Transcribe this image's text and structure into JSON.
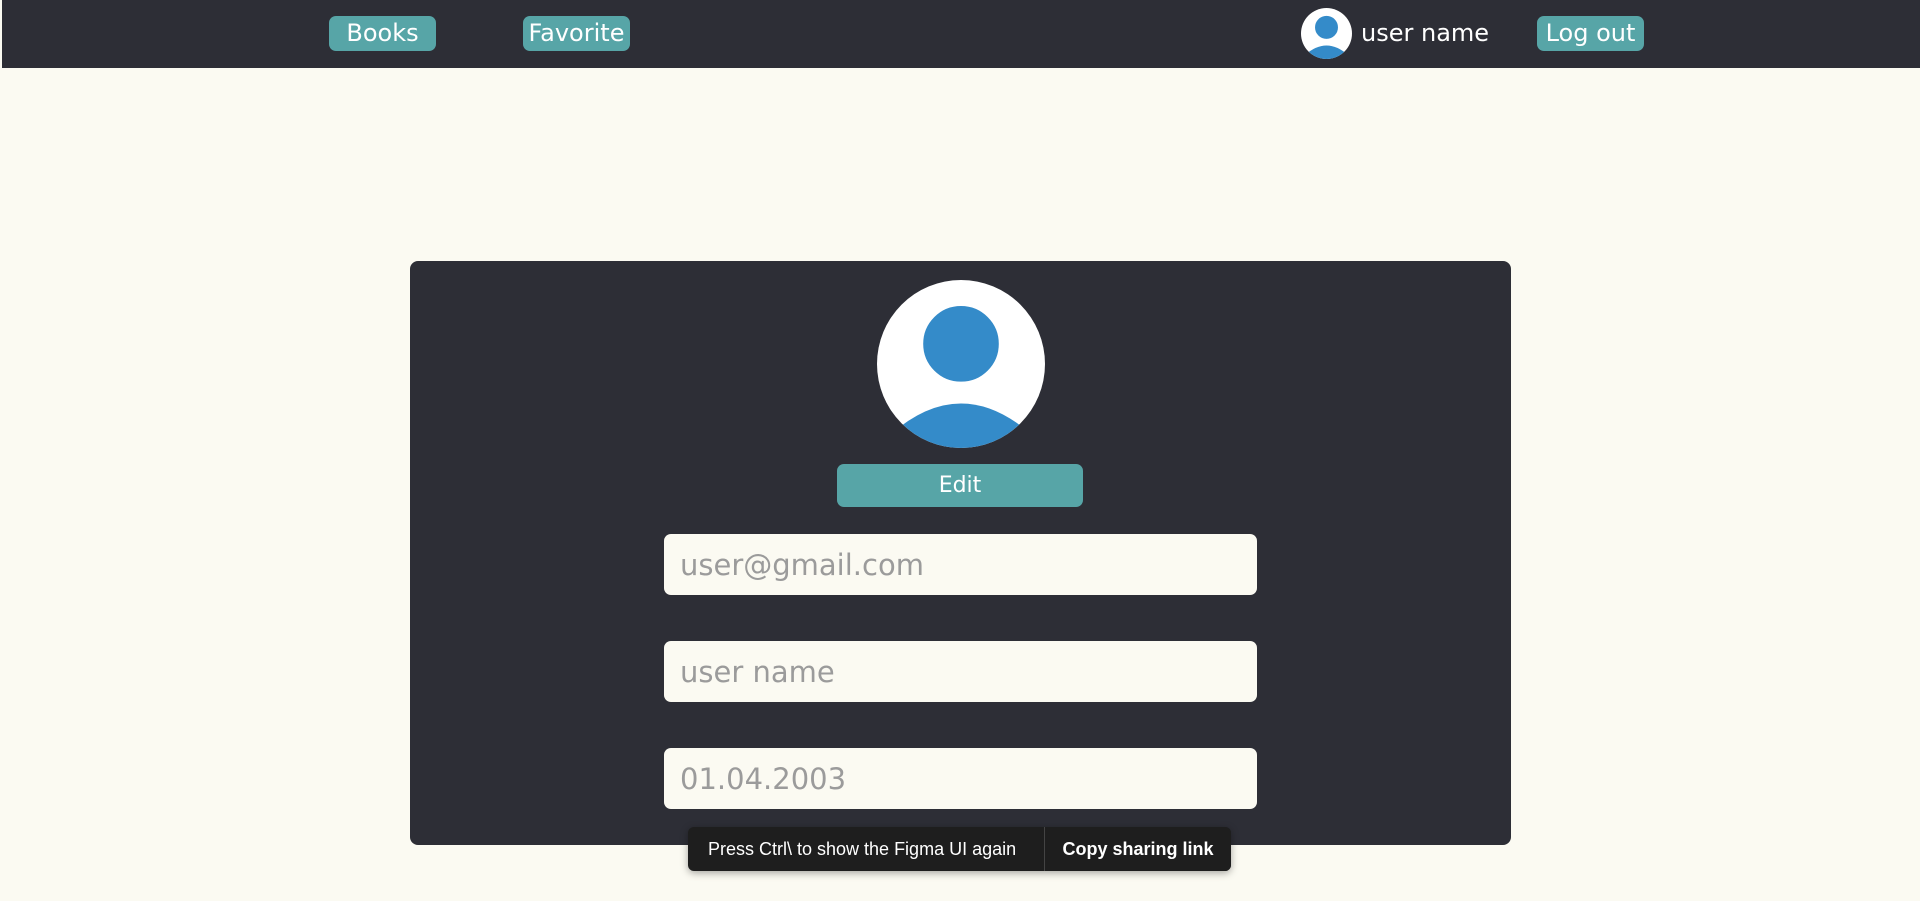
{
  "header": {
    "nav": {
      "books_label": "Books",
      "favorite_label": "Favorite"
    },
    "user_name": "user name",
    "logout_label": "Log out"
  },
  "profile": {
    "edit_label": "Edit",
    "fields": {
      "email_placeholder": "user@gmail.com",
      "username_placeholder": "user name",
      "birthdate_placeholder": "01.04.2003"
    }
  },
  "figma_toast": {
    "message": "Press Ctrl\\ to show the Figma UI again",
    "copy_link_label": "Copy sharing link"
  },
  "colors": {
    "accent": "#57a5a7",
    "dark_panel": "#2d2e36",
    "page_background": "#fbfaf2",
    "avatar_blue": "#348bc9"
  },
  "icons": {
    "user_avatar": "user-avatar-icon"
  }
}
